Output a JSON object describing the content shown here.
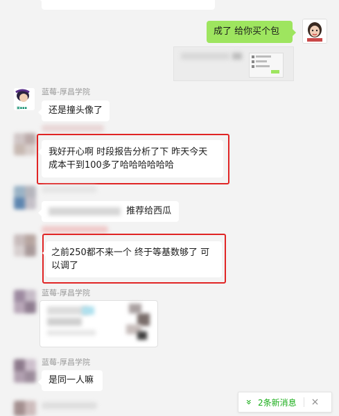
{
  "messages": {
    "m1_text": "成了  给你买个包",
    "m2_name": "蓝莓-厚昌学院",
    "m2_text": "还是撞头像了",
    "m3_text": "我好开心啊  时段报告分析了下  昨天今天成本干到100多了哈哈哈哈哈哈",
    "m4_text": "推荐给西瓜",
    "m5_text": "之前250都不来一个  终于等基数够了  可以调了",
    "m6_name": "蓝莓-厚昌学院",
    "m7_name": "蓝莓-厚昌学院",
    "m7_text": "是同一人嘛"
  },
  "notification": {
    "chevron": "«",
    "label": "2条新消息",
    "close": "×"
  },
  "colors": {
    "accent_green": "#1aad19",
    "bubble_green": "#9ee55f",
    "highlight_red": "#e02424"
  },
  "icons": [
    "avatar-image",
    "chevron-double-down-icon",
    "close-icon"
  ]
}
